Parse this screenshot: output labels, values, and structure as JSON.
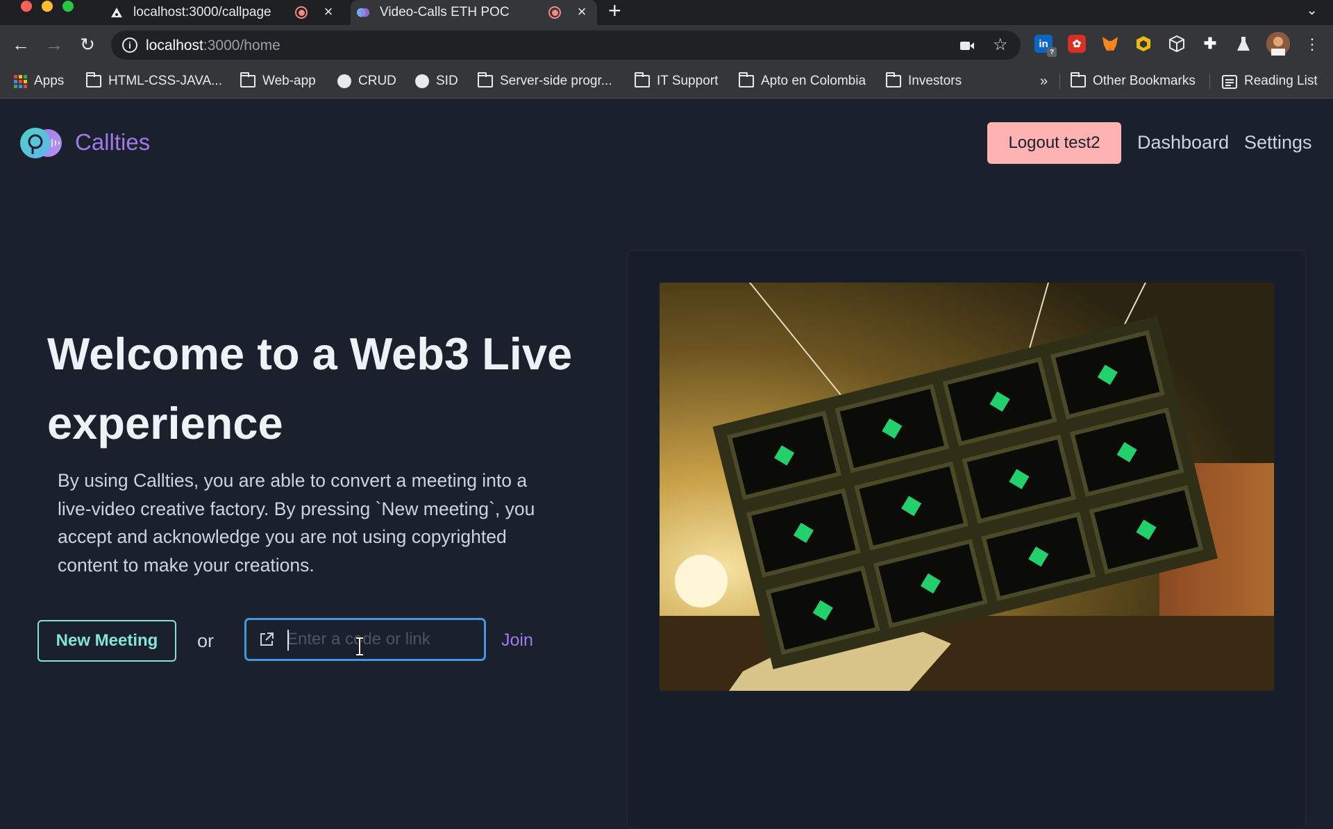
{
  "browser": {
    "tabs": [
      {
        "title": "localhost:3000/callpage",
        "active": false,
        "icon": "triangle-icon"
      },
      {
        "title": "Video-Calls ETH POC",
        "active": true,
        "icon": "callties-logo-icon"
      }
    ],
    "address": {
      "host": "localhost",
      "path": ":3000/home"
    },
    "bookmarks": [
      {
        "label": "Apps",
        "icon": "apps-grid-icon"
      },
      {
        "label": "HTML-CSS-JAVA...",
        "icon": "folder-icon"
      },
      {
        "label": "Web-app",
        "icon": "folder-icon"
      },
      {
        "label": "CRUD",
        "icon": "globe-icon"
      },
      {
        "label": "SID",
        "icon": "globe-icon"
      },
      {
        "label": "Server-side progr...",
        "icon": "folder-icon"
      },
      {
        "label": "IT Support",
        "icon": "folder-icon"
      },
      {
        "label": "Apto en Colombia",
        "icon": "folder-icon"
      },
      {
        "label": "Investors",
        "icon": "folder-icon"
      }
    ],
    "bookmarks_overflow": "»",
    "other_bookmarks": "Other Bookmarks",
    "reading_list": "Reading List",
    "extension_badge": "?"
  },
  "header": {
    "brand": "Callties",
    "logout_label": "Logout test2",
    "nav": {
      "dashboard": "Dashboard",
      "settings": "Settings"
    }
  },
  "hero": {
    "headline_line1": "Welcome to a Web3 Live",
    "headline_line2": "experience",
    "description": "By using Callties, you are able to convert a meeting into a live-video creative factory. By pressing `New meeting`, you accept and acknowledge you are not using copyrighted content to make your creations."
  },
  "actions": {
    "new_meeting_label": "New Meeting",
    "or_text": "or",
    "code_input_placeholder": "Enter a code or link",
    "code_input_value": "",
    "join_label": "Join"
  },
  "colors": {
    "page_bg": "#1a202c",
    "brand": "#9f7aea",
    "logout_bg": "#feb2b2",
    "teal": "#81e6d9",
    "input_focus": "#4299e1"
  }
}
